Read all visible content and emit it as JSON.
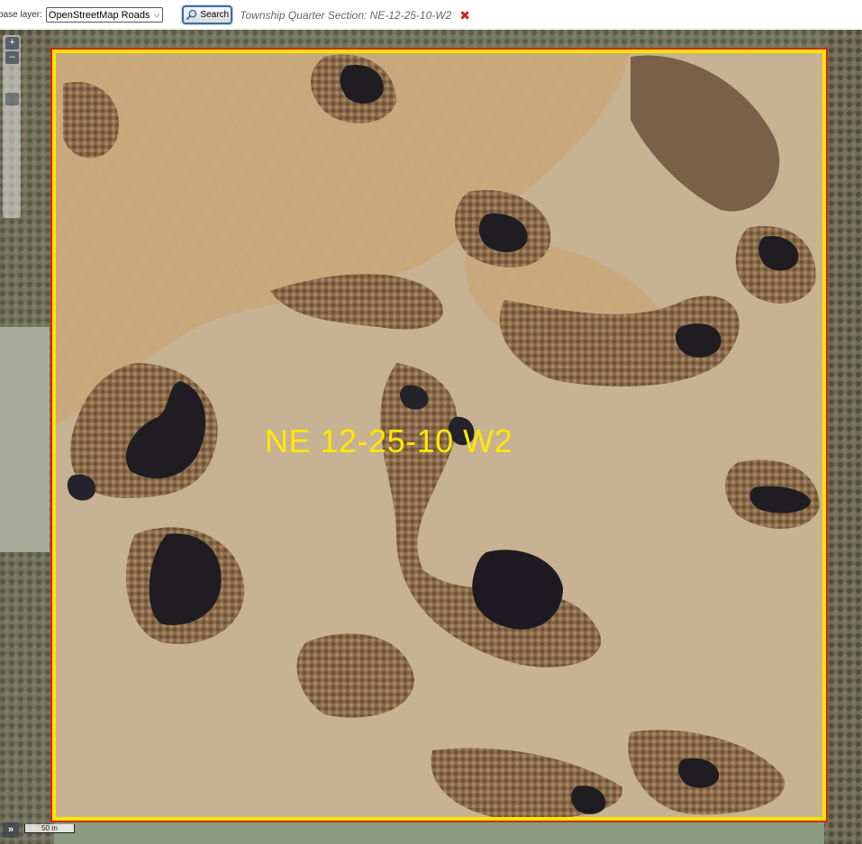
{
  "toolbar": {
    "base_layer_label": "base layer:",
    "base_layer_value": "OpenStreetMap Roads",
    "search_label": "Search",
    "selection_text": "Township Quarter Section: NE-12-25-10-W2",
    "clear_icon": "close-icon",
    "clear_glyph": "✖"
  },
  "map": {
    "parcel_label": "NE 12-25-10 W2",
    "boundary_color": "#ffe600",
    "zoom_in_glyph": "+",
    "zoom_out_glyph": "–",
    "expand_glyph": "»",
    "scale_label": "50 m"
  }
}
